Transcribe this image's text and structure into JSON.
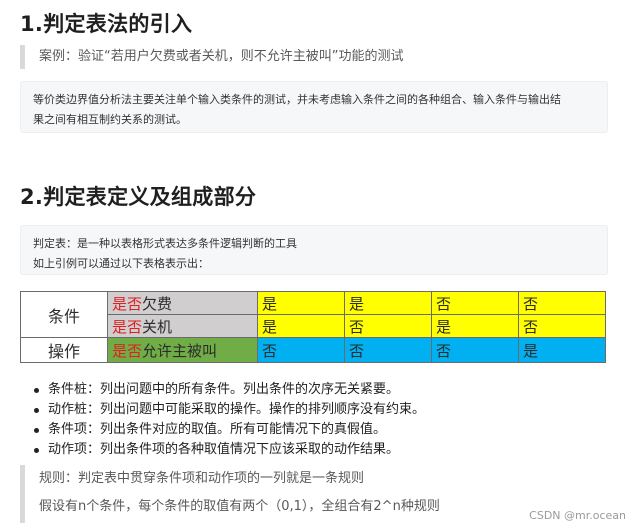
{
  "section1": {
    "title": "1.判定表法的引入",
    "quote": "案例：验证“若用户欠费或者关机，则不允许主被叫”功能的测试",
    "code_lines": [
      "等价类边界值分析法主要关注单个输入类条件的测试，并未考虑输入条件之间的各种组合、输入条件与输出结",
      "果之间有相互制约关系的测试。"
    ]
  },
  "section2": {
    "title": "2.判定表定义及组成部分",
    "code_lines": [
      "判定表：是一种以表格形式表达多条件逻辑判断的工具",
      "如上引例可以通过以下表格表示出："
    ]
  },
  "table": {
    "condition_label": "条件",
    "action_label": "操作",
    "yes_no_prefix": "是否",
    "rows": [
      {
        "name": "欠费",
        "values": [
          "是",
          "是",
          "否",
          "否"
        ]
      },
      {
        "name": "关机",
        "values": [
          "是",
          "否",
          "是",
          "否"
        ]
      }
    ],
    "action": {
      "name": "允许主被叫",
      "values": [
        "否",
        "否",
        "否",
        "是"
      ]
    },
    "colors": {
      "condition_bg": "#d0cece",
      "action_bg": "#70ad47",
      "yes_no_text": "#e02020",
      "cond_values_bg": "#ffff00",
      "action_values_bg": "#00b0f0"
    }
  },
  "bullets": [
    "条件桩：列出问题中的所有条件。列出条件的次序无关紧要。",
    "动作桩：列出问题中可能采取的操作。操作的排列顺序没有约束。",
    "条件项：列出条件对应的取值。所有可能情况下的真假值。",
    "动作项：列出条件项的各种取值情况下应该采取的动作结果。"
  ],
  "quote2": {
    "lines": [
      "规则：判定表中贯穿条件项和动作项的一列就是一条规则",
      "假设有n个条件，每个条件的取值有两个（0,1），全组合有2^n种规则"
    ]
  },
  "watermark": "CSDN @mr.ocean"
}
